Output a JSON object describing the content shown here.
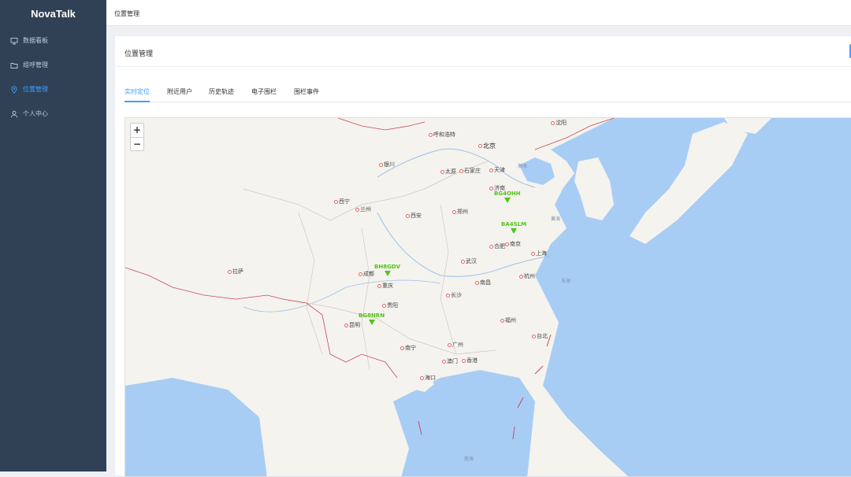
{
  "app": {
    "title": "NovaTalk"
  },
  "sidebar": {
    "items": [
      {
        "label": "数据看板",
        "icon": "monitor-icon"
      },
      {
        "label": "组呼管理",
        "icon": "folder-icon"
      },
      {
        "label": "位置管理",
        "icon": "location-icon",
        "active": true
      },
      {
        "label": "个人中心",
        "icon": "user-icon"
      }
    ]
  },
  "breadcrumb": {
    "current": "位置管理"
  },
  "card": {
    "title": "位置管理"
  },
  "tabs": [
    {
      "label": "实时定位",
      "active": true
    },
    {
      "label": "附近用户"
    },
    {
      "label": "历史轨迹"
    },
    {
      "label": "电子围栏"
    },
    {
      "label": "围栏事件"
    }
  ],
  "map": {
    "zoom_in": "+",
    "zoom_out": "−",
    "cities": {
      "huhehaote": "呼和浩特",
      "shenyang": "沈阳",
      "beijing": "北京",
      "yinchuan": "银川",
      "taiyuan": "太原",
      "shijiazhuang": "石家庄",
      "tianjin": "天津",
      "jinan": "济南",
      "xining": "西宁",
      "lanzhou": "兰州",
      "xian": "西安",
      "zhengzhou": "郑州",
      "hefei": "合肥",
      "nanjing": "南京",
      "shanghai": "上海",
      "wuhan": "武汉",
      "lasa": "拉萨",
      "chengdu": "成都",
      "chongqing": "重庆",
      "hangzhou": "杭州",
      "nanchang": "南昌",
      "changsha": "长沙",
      "guiyang": "贵阳",
      "kunming": "昆明",
      "fuzhou": "福州",
      "taibei": "台北",
      "nanning": "南宁",
      "guangzhou": "广州",
      "aomen": "澳门",
      "xianggang": "香港",
      "haikou": "海口"
    },
    "seas": {
      "bohai": "渤海",
      "huanghai": "黄海",
      "donghai": "东海",
      "nanhai": "南海"
    },
    "markers": [
      "BG4OHH",
      "BA4SLM",
      "BH8GDV",
      "BG8NRN"
    ],
    "marker_color": "#52c41a"
  }
}
